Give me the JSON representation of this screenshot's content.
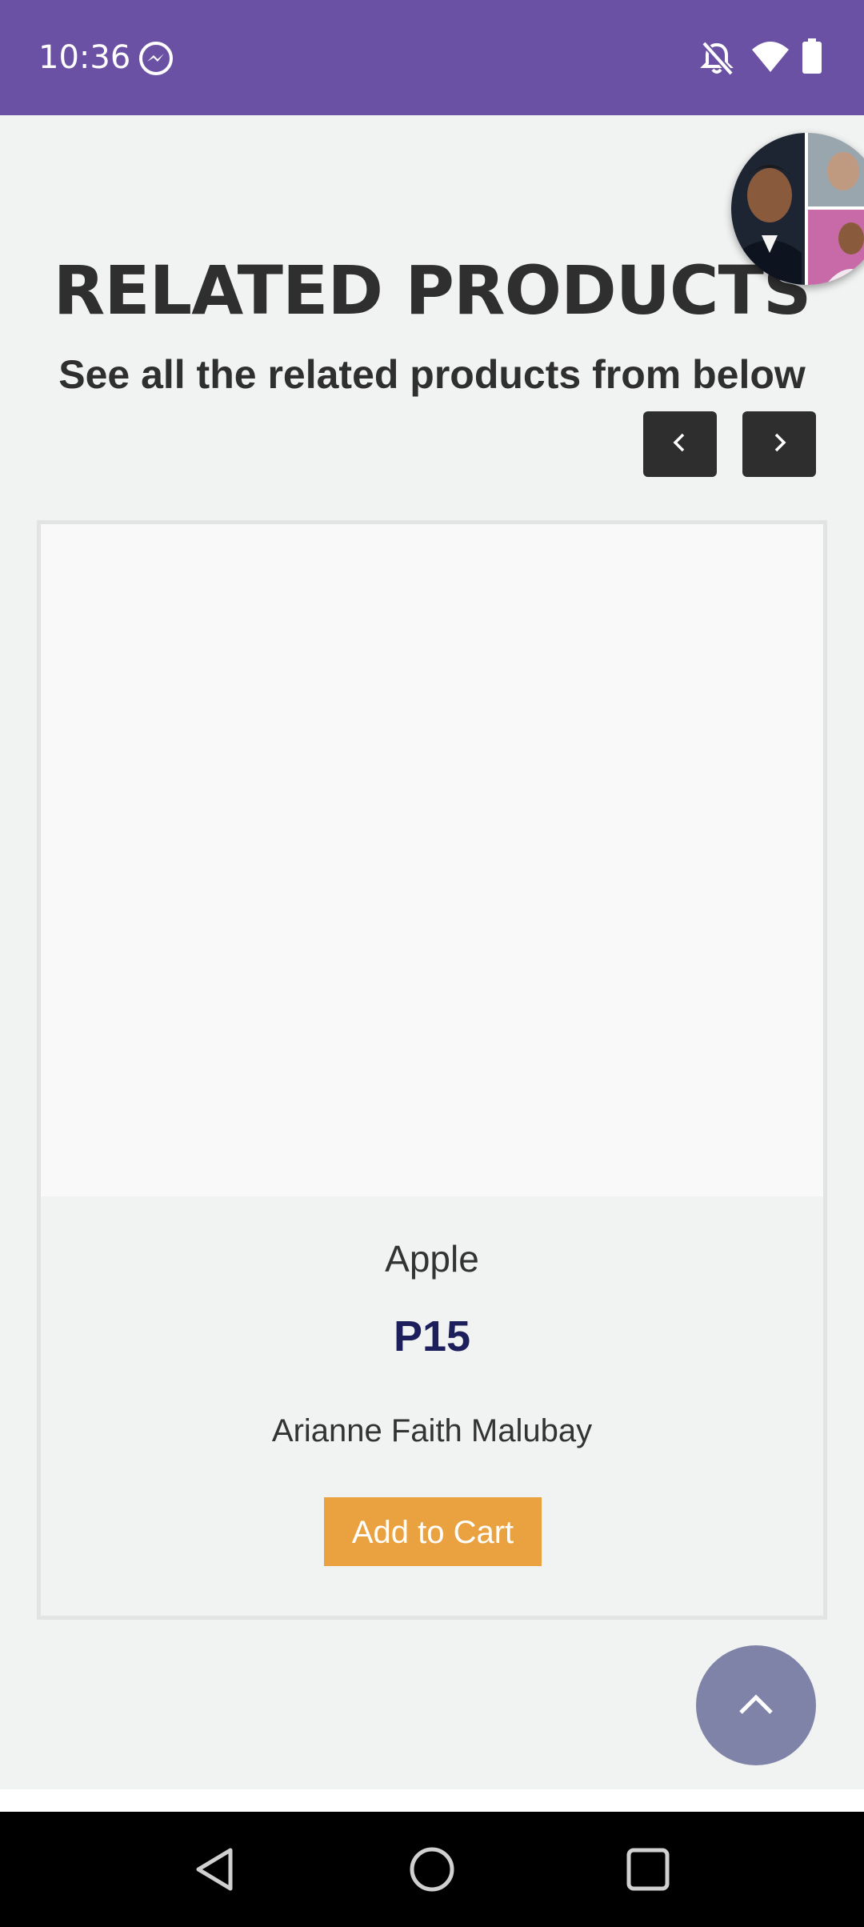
{
  "status_bar": {
    "time": "10:36",
    "background_color": "#6a51a3",
    "icons": [
      "messenger-icon",
      "notifications-off-icon",
      "wifi-icon",
      "battery-icon"
    ]
  },
  "section": {
    "title": "RELATED PRODUCTS",
    "subtitle": "See all the related products from below"
  },
  "carousel": {
    "prev_icon": "chevron-left-icon",
    "next_icon": "chevron-right-icon"
  },
  "product": {
    "name": "Apple",
    "price": "P15",
    "seller": "Arianne Faith Malubay",
    "add_to_cart_label": "Add to Cart",
    "accent_color": "#eaa240",
    "price_color": "#1d1f5c"
  },
  "scroll_top": {
    "icon": "chevron-up-icon",
    "color": "#7f83a8"
  },
  "chat_head": {
    "icon": "group-chat-avatar"
  },
  "system_nav": {
    "icons": [
      "back-icon",
      "home-icon",
      "recents-icon"
    ]
  }
}
